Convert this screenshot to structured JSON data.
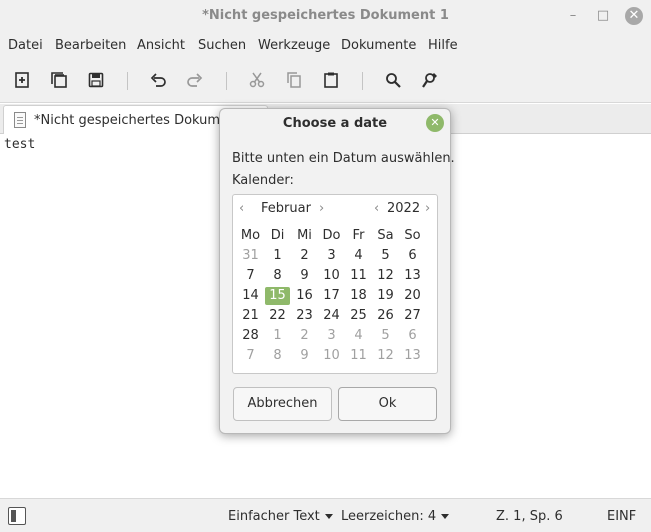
{
  "window": {
    "title": "*Nicht gespeichertes Dokument 1",
    "close_glyph": "✕",
    "maximize_glyph": "□",
    "minimize_glyph": "–"
  },
  "menu": [
    "Datei",
    "Bearbeiten",
    "Ansicht",
    "Suchen",
    "Werkzeuge",
    "Dokumente",
    "Hilfe"
  ],
  "toolbar": {
    "icons": [
      "new-document-icon",
      "open-document-icon",
      "save-icon",
      "undo-icon",
      "redo-icon",
      "cut-icon",
      "copy-icon",
      "paste-icon",
      "search-icon",
      "replace-icon"
    ]
  },
  "tab": {
    "label": "*Nicht gespeichertes Dokumen"
  },
  "editor": {
    "text": "test"
  },
  "statusbar": {
    "language": "Einfacher Text",
    "indent": "Leerzeichen: 4",
    "position": "Z. 1, Sp. 6",
    "mode": "EINF"
  },
  "dialog": {
    "title": "Choose a date",
    "prompt": "Bitte unten ein Datum auswählen.",
    "calendar_label": "Kalender:",
    "month": "Februar",
    "year": "2022",
    "prev_glyph": "‹",
    "next_glyph": "›",
    "weekdays": [
      "Mo",
      "Di",
      "Mi",
      "Do",
      "Fr",
      "Sa",
      "So"
    ],
    "days": [
      "31",
      "1",
      "2",
      "3",
      "4",
      "5",
      "6",
      "7",
      "8",
      "9",
      "10",
      "11",
      "12",
      "13",
      "14",
      "15",
      "16",
      "17",
      "18",
      "19",
      "20",
      "21",
      "22",
      "23",
      "24",
      "25",
      "26",
      "27",
      "28",
      "1",
      "2",
      "3",
      "4",
      "5",
      "6",
      "7",
      "8",
      "9",
      "10",
      "11",
      "12",
      "13"
    ],
    "selected_day": "15",
    "cancel_label": "Abbrechen",
    "ok_label": "Ok",
    "accent_color": "#8fb96a"
  }
}
